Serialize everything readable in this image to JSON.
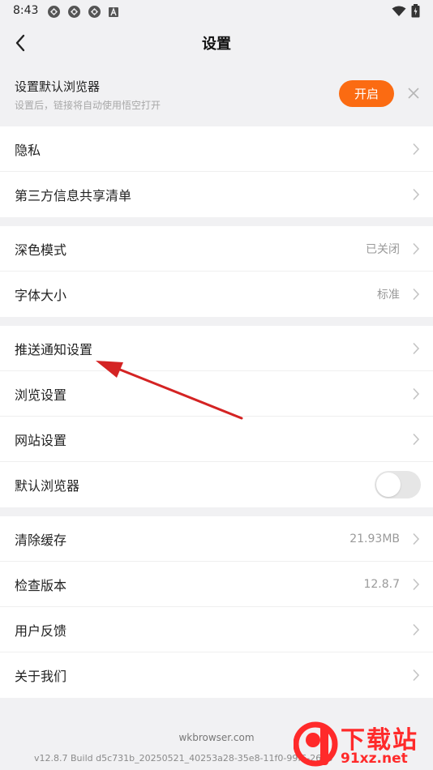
{
  "status_bar": {
    "time": "8:43"
  },
  "header": {
    "title": "设置",
    "back_icon": "chevron-left-icon"
  },
  "banner": {
    "title": "设置默认浏览器",
    "subtitle": "设置后，链接将自动使用悟空打开",
    "open_label": "开启",
    "accent": "#fb6b12"
  },
  "groups": [
    {
      "rows": [
        {
          "label": "隐私"
        },
        {
          "label": "第三方信息共享清单"
        }
      ]
    },
    {
      "rows": [
        {
          "label": "深色模式",
          "value": "已关闭"
        },
        {
          "label": "字体大小",
          "value": "标准"
        }
      ]
    },
    {
      "rows": [
        {
          "label": "推送通知设置"
        },
        {
          "label": "浏览设置"
        },
        {
          "label": "网站设置"
        },
        {
          "label": "默认浏览器",
          "toggle": false
        }
      ]
    },
    {
      "rows": [
        {
          "label": "清除缓存",
          "value": "21.93MB"
        },
        {
          "label": "检查版本",
          "value": "12.8.7"
        },
        {
          "label": "用户反馈"
        },
        {
          "label": "关于我们"
        }
      ]
    }
  ],
  "footer": {
    "domain": "wkbrowser.com",
    "build": "v12.8.7 Build d5c731b_20250521_40253a28-35e8-11f0-99f6-2616"
  },
  "watermark": {
    "top": "下载站",
    "bottom": "91xz.net"
  },
  "annotation_color": "#d42323"
}
